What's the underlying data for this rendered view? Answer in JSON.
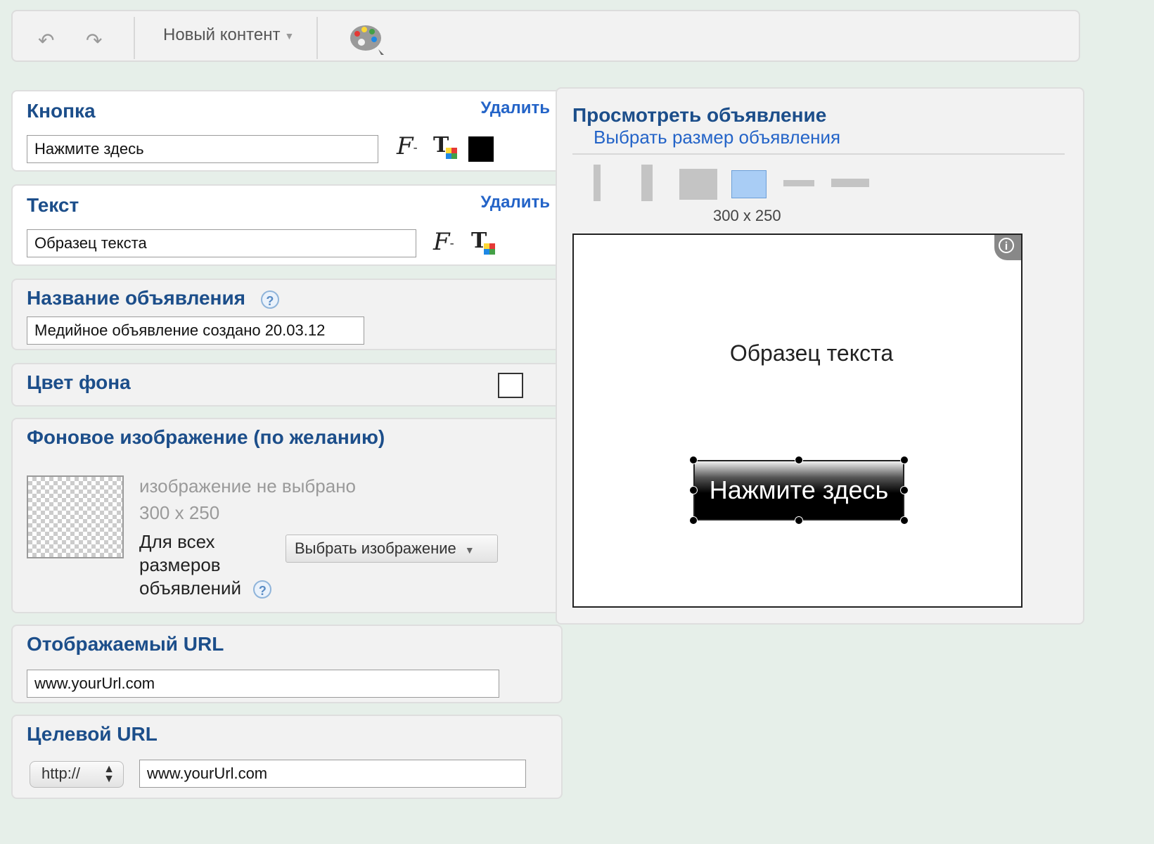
{
  "toolbar": {
    "undo_icon": "undo-icon",
    "redo_icon": "redo-icon",
    "new_content_label": "Новый контент",
    "palette_icon": "palette-icon"
  },
  "button_section": {
    "title": "Кнопка",
    "delete_label": "Удалить",
    "input_value": "Нажмите здесь",
    "color": "#000000"
  },
  "text_section": {
    "title": "Текст",
    "delete_label": "Удалить",
    "input_value": "Образец текста"
  },
  "ad_name_section": {
    "title": "Название объявления",
    "help": "?",
    "input_value": "Медийное объявление создано 20.03.12"
  },
  "bg_color_section": {
    "title": "Цвет фона",
    "color": "#ffffff"
  },
  "bg_image_section": {
    "title": "Фоновое изображение (по желанию)",
    "no_image_text": "изображение не выбрано",
    "size_text": "300 x 250",
    "all_sizes_line1": "Для всех",
    "all_sizes_line2": "размеров",
    "all_sizes_line3": "объявлений",
    "help": "?",
    "select_button_label": "Выбрать изображение"
  },
  "display_url_section": {
    "title": "Отображаемый URL",
    "input_value": "www.yourUrl.com"
  },
  "target_url_section": {
    "title": "Целевой URL",
    "protocol_value": "http://",
    "input_value": "www.yourUrl.com"
  },
  "preview": {
    "title": "Просмотреть объявление",
    "choose_size_link": "Выбрать размер объявления",
    "selected_size": "300 x 250",
    "ad_text": "Образец текста",
    "ad_button_text": "Нажмите здесь",
    "info_icon": "info-icon"
  }
}
